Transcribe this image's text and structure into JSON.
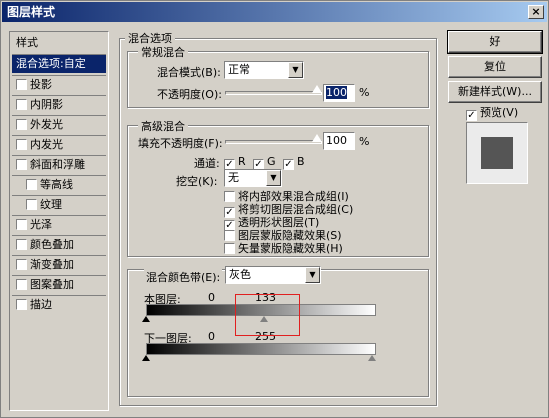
{
  "window": {
    "title": "图层样式",
    "close_glyph": "×"
  },
  "sidebar": {
    "header": "样式",
    "items": [
      {
        "label": "混合选项:自定",
        "selected": true,
        "checkbox": false
      },
      {
        "label": "投影",
        "checkbox": true,
        "checked": false
      },
      {
        "label": "内阴影",
        "checkbox": true,
        "checked": false
      },
      {
        "label": "外发光",
        "checkbox": true,
        "checked": false
      },
      {
        "label": "内发光",
        "checkbox": true,
        "checked": false
      },
      {
        "label": "斜面和浮雕",
        "checkbox": true,
        "checked": false
      },
      {
        "label": "等高线",
        "checkbox": true,
        "checked": false,
        "indent": true
      },
      {
        "label": "纹理",
        "checkbox": true,
        "checked": false,
        "indent": true
      },
      {
        "label": "光泽",
        "checkbox": true,
        "checked": false
      },
      {
        "label": "颜色叠加",
        "checkbox": true,
        "checked": false
      },
      {
        "label": "渐变叠加",
        "checkbox": true,
        "checked": false
      },
      {
        "label": "图案叠加",
        "checkbox": true,
        "checked": false
      },
      {
        "label": "描边",
        "checkbox": true,
        "checked": false
      }
    ]
  },
  "blending_options": {
    "title": "混合选项",
    "general": {
      "title": "常规混合",
      "blend_mode_label": "混合模式(B):",
      "blend_mode_value": "正常",
      "opacity_label": "不透明度(O):",
      "opacity_value": "100",
      "opacity_unit": "%"
    },
    "advanced": {
      "title": "高级混合",
      "fill_label": "填充不透明度(F):",
      "fill_value": "100",
      "fill_unit": "%",
      "channels_label": "通道:",
      "channels": [
        {
          "label": "R",
          "checked": true
        },
        {
          "label": "G",
          "checked": true
        },
        {
          "label": "B",
          "checked": true
        }
      ],
      "knockout_label": "挖空(K):",
      "knockout_value": "无",
      "options": [
        {
          "label": "将内部效果混合成组(I)",
          "checked": false
        },
        {
          "label": "将剪切图层混合成组(C)",
          "checked": true
        },
        {
          "label": "透明形状图层(T)",
          "checked": true
        },
        {
          "label": "图层蒙版隐藏效果(S)",
          "checked": false
        },
        {
          "label": "矢量蒙版隐藏效果(H)",
          "checked": false
        }
      ]
    },
    "blend_if": {
      "label": "混合颜色带(E):",
      "value": "灰色",
      "this_layer_label": "本图层:",
      "this_layer_low": "0",
      "this_layer_high": "133",
      "underlying_label": "下一图层:",
      "underlying_low": "0",
      "underlying_high": "255"
    }
  },
  "buttons": {
    "ok": "好",
    "reset": "复位",
    "new_style": "新建样式(W)...",
    "preview_label": "预览(V)",
    "preview_checked": true
  },
  "check_glyph": "✓",
  "arrow_glyph": "▼"
}
